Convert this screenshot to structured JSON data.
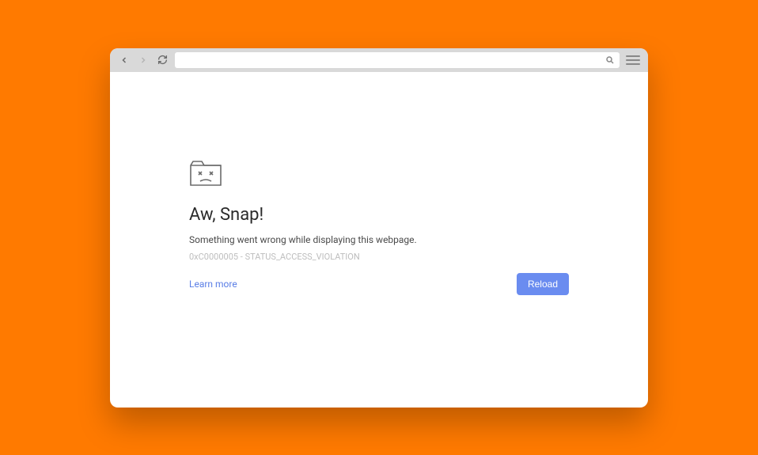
{
  "toolbar": {
    "address_value": "",
    "address_placeholder": ""
  },
  "error": {
    "title": "Aw, Snap!",
    "message": "Something went wrong while displaying this webpage.",
    "code": "0xC0000005 - STATUS_ACCESS_VIOLATION",
    "learn_more": "Learn more",
    "reload": "Reload"
  }
}
